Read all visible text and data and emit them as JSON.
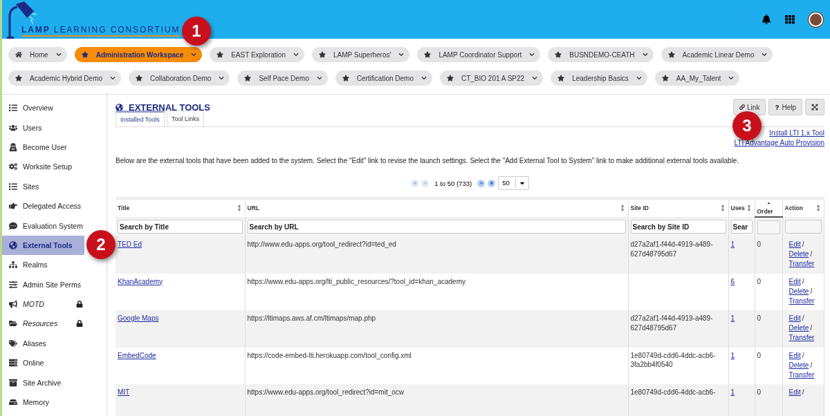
{
  "header": {
    "logo_bold": "LAMP",
    "logo_rest": "LEARNING CONSORTIUM"
  },
  "site_tabs": [
    {
      "label": "Home",
      "kind": "home",
      "selected": false
    },
    {
      "label": "Administration Workspace",
      "kind": "site",
      "selected": true
    },
    {
      "label": "EAST Exploration",
      "kind": "site",
      "selected": false
    },
    {
      "label": "LAMP Superheros'",
      "kind": "site",
      "selected": false
    },
    {
      "label": "LAMP Coordinator Support",
      "kind": "site",
      "selected": false
    },
    {
      "label": "BUSNDEMO-CEATH",
      "kind": "site",
      "selected": false
    },
    {
      "label": "Academic Linear Demo",
      "kind": "site",
      "selected": false
    },
    {
      "label": "Academic Hybrid Demo",
      "kind": "site",
      "selected": false
    },
    {
      "label": "Collaboration Demo",
      "kind": "site",
      "selected": false
    },
    {
      "label": "Self Pace Demo",
      "kind": "site",
      "selected": false
    },
    {
      "label": "Certification Demo",
      "kind": "site",
      "selected": false
    },
    {
      "label": "CT_BIO 201 A SP22",
      "kind": "site",
      "selected": false
    },
    {
      "label": "Leadership Basics",
      "kind": "site",
      "selected": false
    },
    {
      "label": "AA_My_Talent",
      "kind": "site",
      "selected": false
    }
  ],
  "sidebar": {
    "items": [
      {
        "label": "Overview",
        "selected": false,
        "locked": false
      },
      {
        "label": "Users",
        "selected": false,
        "locked": false
      },
      {
        "label": "Become User",
        "selected": false,
        "locked": false
      },
      {
        "label": "Worksite Setup",
        "selected": false,
        "locked": false
      },
      {
        "label": "Sites",
        "selected": false,
        "locked": false
      },
      {
        "label": "Delegated Access",
        "selected": false,
        "locked": false
      },
      {
        "label": "Evaluation System",
        "selected": false,
        "locked": false
      },
      {
        "label": "External Tools",
        "selected": true,
        "locked": false
      },
      {
        "label": "Realms",
        "selected": false,
        "locked": false
      },
      {
        "label": "Admin Site Perms",
        "selected": false,
        "locked": false
      },
      {
        "label": "MOTD",
        "selected": false,
        "locked": true
      },
      {
        "label": "Resources",
        "selected": false,
        "locked": true
      },
      {
        "label": "Aliases",
        "selected": false,
        "locked": false
      },
      {
        "label": "Online",
        "selected": false,
        "locked": false
      },
      {
        "label": "Site Archive",
        "selected": false,
        "locked": false
      },
      {
        "label": "Memory",
        "selected": false,
        "locked": false
      }
    ]
  },
  "page": {
    "title": "EXTERNAL TOOLS",
    "buttons": [
      {
        "label": "Link",
        "kind": "link"
      },
      {
        "label": "Help",
        "kind": "help"
      },
      {
        "kind": "expand"
      }
    ],
    "tabs": [
      {
        "label": "Installed Tools",
        "selected": true
      },
      {
        "label": "Tool Links",
        "selected": false
      }
    ],
    "links": [
      "Install LTI 1.x Tool",
      "LTI Advantage Auto Provision"
    ],
    "description": "Below are the external tools that have been added to the system. Select the \"Edit\" link to revise the launch settings. Select the \"Add External Tool to System\" link to make additional external tools available.",
    "pager": {
      "range": "1 to 50 (733)",
      "page_size": "50"
    }
  },
  "table": {
    "columns": [
      {
        "label": "Title",
        "sorted": false,
        "placeholder": "Search by Title"
      },
      {
        "label": "URL",
        "sorted": false,
        "placeholder": "Search by URL"
      },
      {
        "label": "Site ID",
        "sorted": false,
        "placeholder": "Search by Site ID"
      },
      {
        "label": "Uses",
        "sorted": false,
        "placeholder": "Sear"
      },
      {
        "label": "Order",
        "sorted": true
      },
      {
        "label": "Action",
        "sorted": false
      }
    ],
    "rows": [
      {
        "title": "TED Ed",
        "url": "http://www.edu-apps.org/tool_redirect?id=ted_ed",
        "site_id": "d27a2af1-f44d-4919-a489-627d48795d67",
        "uses": "1",
        "order": "0",
        "actions": [
          {
            "label": "Edit",
            "separator": "/"
          },
          {
            "label": "Delete",
            "separator": "/"
          },
          {
            "label": "Transfer"
          }
        ]
      },
      {
        "title": "KhanAcademy",
        "url": "https://www.edu-apps.org/lti_public_resources/?tool_id=khan_academy",
        "site_id": "",
        "uses": "6",
        "order": "0",
        "actions": [
          {
            "label": "Edit",
            "separator": "/"
          },
          {
            "label": "Delete",
            "separator": "/"
          },
          {
            "label": "Transfer"
          }
        ]
      },
      {
        "title": "Google Maps",
        "url": "https://ltimaps.aws.af.cm/ltimaps/map.php",
        "site_id": "d27a2af1-f44d-4919-a489-627d48795d67",
        "uses": "1",
        "order": "0",
        "actions": [
          {
            "label": "Edit",
            "separator": "/"
          },
          {
            "label": "Delete",
            "separator": "/"
          },
          {
            "label": "Transfer"
          }
        ]
      },
      {
        "title": "EmbedCode",
        "url": "https://code-embed-lti.herokuapp.com/tool_config.xml",
        "site_id": "1e80749d-cdd6-4ddc-acb6-3fa2bb4f0540",
        "uses": "1",
        "order": "0",
        "actions": [
          {
            "label": "Edit",
            "separator": "/"
          },
          {
            "label": "Delete",
            "separator": "/"
          },
          {
            "label": "Transfer"
          }
        ]
      },
      {
        "title": "MIT",
        "url": "https://www.edu-apps.org/tool_redirect?id=mit_ocw",
        "site_id": "1e80749d-cdd6-4ddc-acb6-",
        "uses": "1",
        "order": "0",
        "actions": [
          {
            "label": "Edit",
            "separator": "/"
          }
        ]
      }
    ]
  },
  "callouts": [
    "1",
    "2",
    "3"
  ]
}
